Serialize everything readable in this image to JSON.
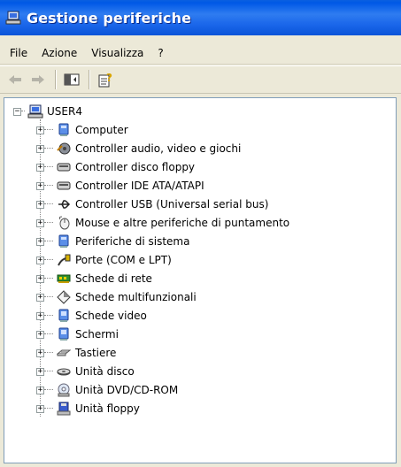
{
  "window": {
    "title": "Gestione periferiche"
  },
  "menu": [
    "File",
    "Azione",
    "Visualizza",
    "?"
  ],
  "tree": {
    "root": "USER4",
    "children": [
      {
        "label": "Computer",
        "icon": "computer-icon"
      },
      {
        "label": "Controller audio, video e giochi",
        "icon": "audio-icon"
      },
      {
        "label": "Controller disco floppy",
        "icon": "floppy-controller-icon"
      },
      {
        "label": "Controller IDE ATA/ATAPI",
        "icon": "ide-controller-icon"
      },
      {
        "label": "Controller USB (Universal serial bus)",
        "icon": "usb-icon"
      },
      {
        "label": "Mouse e altre periferiche di puntamento",
        "icon": "mouse-icon"
      },
      {
        "label": "Periferiche di sistema",
        "icon": "system-device-icon"
      },
      {
        "label": "Porte (COM e LPT)",
        "icon": "port-icon"
      },
      {
        "label": "Schede di rete",
        "icon": "network-card-icon"
      },
      {
        "label": "Schede multifunzionali",
        "icon": "multifunction-icon"
      },
      {
        "label": "Schede video",
        "icon": "video-card-icon"
      },
      {
        "label": "Schermi",
        "icon": "monitor-icon"
      },
      {
        "label": "Tastiere",
        "icon": "keyboard-icon"
      },
      {
        "label": "Unità disco",
        "icon": "disk-drive-icon"
      },
      {
        "label": "Unità DVD/CD-ROM",
        "icon": "dvd-icon"
      },
      {
        "label": "Unità floppy",
        "icon": "floppy-drive-icon"
      }
    ]
  }
}
